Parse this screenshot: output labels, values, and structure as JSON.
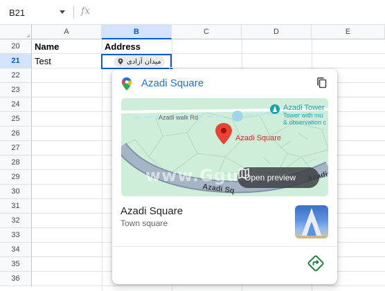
{
  "formula_bar": {
    "name_box": "B21",
    "fx_label": "fx",
    "formula_value": ""
  },
  "columns": [
    "A",
    "B",
    "C",
    "D",
    "E"
  ],
  "selected_column": "B",
  "rows": [
    "20",
    "21",
    "22",
    "23",
    "24",
    "25",
    "26",
    "27",
    "28",
    "29",
    "30",
    "31",
    "32",
    "33",
    "34",
    "35",
    "36"
  ],
  "selected_row": "21",
  "cells": {
    "a20": "Name",
    "b20": "Address",
    "a21": "Test",
    "b21_chip": "میدان آزادی"
  },
  "place_card": {
    "title": "Azadi Square",
    "map": {
      "watermark": "www.Gguide.ir",
      "marker_label": "Azadi Square",
      "poi_label": "Azadi Tower",
      "poi_sub1": "Tower with mu",
      "poi_sub2": "& observation c",
      "road_label_1": "Azadi walk Rd",
      "road_label_2": "Azadi Sq",
      "road_label_3": "Azadi Sq",
      "preview_button": "Open preview"
    },
    "place_name": "Azadi Square",
    "place_type": "Town square"
  },
  "colors": {
    "accent_blue": "#1a73e8",
    "selection_blue": "#0b57d0",
    "marker_red": "#ea4335",
    "poi_teal": "#12a4af",
    "directions_green": "#188038"
  },
  "icons": [
    "dropdown-caret-icon",
    "google-maps-icon",
    "copy-icon",
    "map-pin-icon",
    "map-icon",
    "directions-icon"
  ]
}
